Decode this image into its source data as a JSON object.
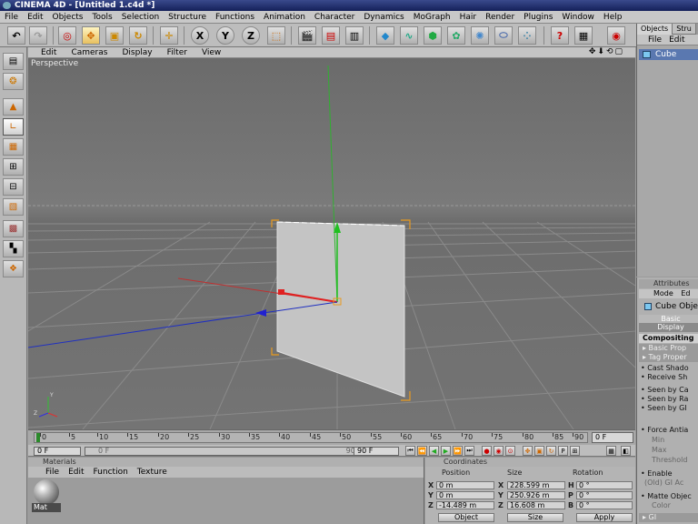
{
  "titlebar": {
    "title": "CINEMA 4D - [Untitled 1.c4d *]"
  },
  "menu": [
    "File",
    "Edit",
    "Objects",
    "Tools",
    "Selection",
    "Structure",
    "Functions",
    "Animation",
    "Character",
    "Dynamics",
    "MoGraph",
    "Hair",
    "Render",
    "Plugins",
    "Window",
    "Help"
  ],
  "toolbar": {
    "axis_x": "X",
    "axis_y": "Y",
    "axis_z": "Z"
  },
  "viewport": {
    "menu": [
      "Edit",
      "Cameras",
      "Display",
      "Filter",
      "View"
    ],
    "label": "Perspective",
    "nav_icons": "✥⬇⟲▢"
  },
  "timeline": {
    "ticks": [
      "0",
      "5",
      "10",
      "15",
      "20",
      "25",
      "30",
      "35",
      "40",
      "45",
      "50",
      "55",
      "60",
      "65",
      "70",
      "75",
      "80",
      "85",
      "90"
    ],
    "current_frame": "0 F"
  },
  "transport": {
    "start": "0 F",
    "range_start": "0 F",
    "range_end": "90 F",
    "end": "90 F"
  },
  "materials": {
    "header": "Materials",
    "menu": [
      "File",
      "Edit",
      "Function",
      "Texture"
    ],
    "mat_label": "Mat"
  },
  "coordinates": {
    "header": "Coordinates",
    "col_position": "Position",
    "col_size": "Size",
    "col_rotation": "Rotation",
    "rows": [
      {
        "axis": "X",
        "pos": "0 m",
        "size_axis": "X",
        "size": "228.599 m",
        "rot_axis": "H",
        "rot": "0 °"
      },
      {
        "axis": "Y",
        "pos": "0 m",
        "size_axis": "Y",
        "size": "250.926 m",
        "rot_axis": "P",
        "rot": "0 °"
      },
      {
        "axis": "Z",
        "pos": "-14.489 m",
        "size_axis": "Z",
        "size": "16.608 m",
        "rot_axis": "B",
        "rot": "0 °"
      }
    ],
    "mode": "Object",
    "size_mode": "Size",
    "apply": "Apply"
  },
  "objects": {
    "tabs": [
      "Objects",
      "Stru"
    ],
    "menu": [
      "File",
      "Edit"
    ],
    "item": "Cube"
  },
  "attributes": {
    "header": "Attributes",
    "menu": [
      "Mode",
      "Ed"
    ],
    "object": "Cube Obje",
    "tab_basic": "Basic",
    "tab_display": "Display",
    "section": "Compositing",
    "sub1": "▸ Basic Prop",
    "sub2": "▸ Tag Proper",
    "props": [
      "Cast Shado",
      "Receive Sh",
      "Seen by Ca",
      "Seen by Ra",
      "Seen by GI",
      "Force Antia",
      "Min",
      "Max",
      "Threshold",
      "Enable",
      "(Old) GI Ac",
      "Matte Objec",
      "Color"
    ],
    "footer": "▸ GI"
  },
  "colors": {
    "accent": "#5a78b0",
    "title": "#14205a",
    "x_axis": "#d02020",
    "y_axis": "#20b020",
    "z_axis": "#2020d0",
    "selection": "#e89a20"
  }
}
